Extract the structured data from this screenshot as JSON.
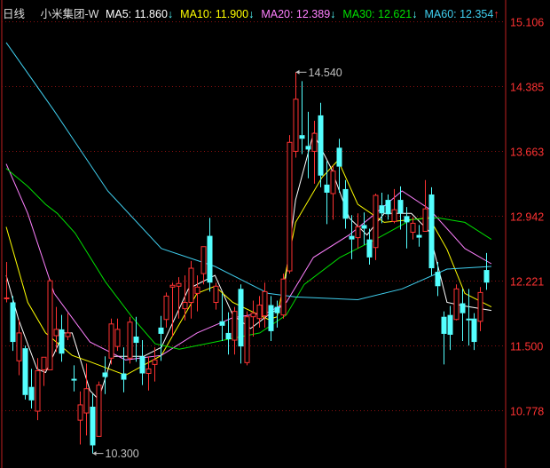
{
  "header": {
    "period": "日线",
    "name": "小米集团-W",
    "ma": [
      {
        "label": "MA5: 11.860",
        "arrow": "↓",
        "color": "#ffffff",
        "arrow_color": "#54ffff"
      },
      {
        "label": "MA10: 11.900",
        "arrow": "↓",
        "color": "#ffff00",
        "arrow_color": "#54ffff"
      },
      {
        "label": "MA20: 12.389",
        "arrow": "↓",
        "color": "#ff80ff",
        "arrow_color": "#54ffff"
      },
      {
        "label": "MA30: 12.621",
        "arrow": "↓",
        "color": "#00e000",
        "arrow_color": "#54ffff"
      },
      {
        "label": "MA60: 12.354",
        "arrow": "↑",
        "color": "#40d0f0",
        "arrow_color": "#ff3232"
      }
    ]
  },
  "colors": {
    "up": "#ff3232",
    "down": "#54ffff",
    "grid": "#8a1010",
    "axis": "#c02020",
    "axis_text": "#ff3232",
    "mark_text": "#c0c0c0"
  },
  "chart_data": {
    "type": "candlestick",
    "title": "小米集团-W 日线",
    "ylim": [
      10.25,
      15.2
    ],
    "yticks": [
      "15.106",
      "14.385",
      "13.663",
      "12.942",
      "12.221",
      "11.500",
      "10.778"
    ],
    "grid": true,
    "annotations": [
      {
        "text": "14.540",
        "index": 47,
        "price": 14.54
      },
      {
        "text": "10.300",
        "index": 14,
        "price": 10.3
      }
    ],
    "ohlc": [
      [
        12.03,
        12.43,
        11.98,
        12.03
      ],
      [
        11.98,
        12.05,
        11.44,
        11.54
      ],
      [
        11.33,
        11.79,
        11.17,
        11.64
      ],
      [
        11.47,
        11.5,
        10.9,
        10.95
      ],
      [
        11.04,
        11.24,
        10.8,
        10.89
      ],
      [
        10.77,
        11.36,
        10.67,
        11.22
      ],
      [
        11.23,
        11.37,
        11.05,
        11.37
      ],
      [
        11.23,
        12.24,
        11.23,
        12.22
      ],
      [
        11.61,
        11.93,
        11.43,
        11.68
      ],
      [
        11.68,
        11.84,
        11.32,
        11.41
      ],
      [
        11.6,
        11.86,
        11.56,
        11.64
      ],
      [
        11.13,
        11.28,
        10.99,
        11.11
      ],
      [
        10.67,
        10.99,
        10.4,
        10.84
      ],
      [
        10.75,
        11.3,
        10.5,
        11.02
      ],
      [
        10.82,
        10.96,
        10.3,
        10.39
      ],
      [
        10.49,
        11.1,
        10.49,
        11.06
      ],
      [
        11.2,
        11.38,
        10.96,
        11.15
      ],
      [
        11.36,
        11.8,
        11.29,
        11.74
      ],
      [
        11.49,
        11.8,
        11.44,
        11.68
      ],
      [
        11.19,
        11.48,
        10.98,
        11.12
      ],
      [
        11.36,
        11.82,
        11.3,
        11.76
      ],
      [
        11.6,
        11.82,
        11.32,
        11.53
      ],
      [
        11.38,
        11.56,
        11.06,
        11.19
      ],
      [
        11.19,
        11.38,
        11.0,
        11.24
      ],
      [
        11.29,
        11.48,
        11.1,
        11.34
      ],
      [
        11.7,
        11.83,
        11.33,
        11.63
      ],
      [
        11.79,
        12.09,
        11.7,
        12.05
      ],
      [
        12.15,
        12.2,
        11.6,
        12.17
      ],
      [
        12.16,
        12.26,
        11.8,
        12.19
      ],
      [
        11.91,
        12.28,
        11.78,
        11.98
      ],
      [
        11.98,
        12.44,
        11.8,
        12.36
      ],
      [
        12.08,
        12.28,
        11.88,
        12.15
      ],
      [
        12.3,
        12.6,
        12.18,
        12.6
      ],
      [
        12.72,
        12.92,
        12.1,
        12.2
      ],
      [
        11.98,
        12.2,
        11.9,
        12.16
      ],
      [
        11.77,
        12.08,
        11.55,
        11.72
      ],
      [
        11.64,
        11.87,
        11.4,
        11.57
      ],
      [
        11.56,
        11.93,
        11.4,
        11.88
      ],
      [
        12.13,
        12.18,
        11.3,
        11.49
      ],
      [
        11.31,
        11.88,
        11.28,
        11.82
      ],
      [
        11.82,
        12.0,
        11.6,
        11.86
      ],
      [
        11.8,
        12.05,
        11.7,
        11.95
      ],
      [
        11.83,
        12.2,
        11.7,
        12.1
      ],
      [
        11.95,
        12.05,
        11.55,
        11.66
      ],
      [
        11.93,
        12.0,
        11.7,
        11.86
      ],
      [
        11.84,
        12.3,
        11.8,
        12.24
      ],
      [
        12.33,
        13.84,
        12.3,
        13.76
      ],
      [
        13.66,
        14.54,
        13.59,
        14.24
      ],
      [
        13.84,
        14.44,
        13.63,
        13.8
      ],
      [
        13.72,
        14.1,
        13.36,
        13.68
      ],
      [
        13.66,
        14.0,
        13.3,
        13.86
      ],
      [
        14.06,
        14.2,
        13.26,
        13.39
      ],
      [
        13.29,
        13.55,
        12.85,
        13.2
      ],
      [
        13.19,
        13.5,
        12.9,
        13.44
      ],
      [
        13.7,
        13.8,
        13.2,
        13.49
      ],
      [
        13.24,
        13.34,
        12.8,
        12.91
      ],
      [
        12.72,
        12.95,
        12.46,
        12.68
      ],
      [
        12.7,
        12.97,
        12.58,
        12.82
      ],
      [
        12.84,
        12.98,
        12.62,
        12.8
      ],
      [
        12.68,
        12.8,
        12.4,
        12.48
      ],
      [
        12.59,
        13.19,
        12.45,
        13.17
      ],
      [
        13.06,
        13.2,
        12.86,
        12.97
      ],
      [
        13.12,
        13.18,
        12.9,
        12.96
      ],
      [
        12.88,
        13.24,
        12.86,
        13.01
      ],
      [
        13.12,
        13.27,
        12.79,
        12.97
      ],
      [
        12.94,
        13.04,
        12.58,
        12.87
      ],
      [
        12.76,
        12.93,
        12.68,
        12.86
      ],
      [
        12.73,
        12.84,
        12.6,
        12.7
      ],
      [
        12.77,
        13.34,
        12.77,
        13.02
      ],
      [
        13.18,
        13.26,
        12.28,
        12.36
      ],
      [
        12.32,
        12.43,
        12.05,
        12.16
      ],
      [
        11.82,
        11.88,
        11.29,
        11.63
      ],
      [
        11.84,
        11.94,
        11.45,
        11.62
      ],
      [
        11.79,
        12.18,
        11.78,
        12.13
      ],
      [
        11.97,
        12.13,
        11.55,
        11.86
      ],
      [
        11.8,
        12.13,
        11.5,
        11.78
      ],
      [
        11.8,
        11.86,
        11.45,
        11.54
      ],
      [
        11.77,
        12.15,
        11.66,
        12.09
      ],
      [
        12.34,
        12.53,
        12.12,
        12.2
      ]
    ],
    "ma_series": [
      {
        "name": "MA5",
        "color": "#ffffff",
        "points": [
          [
            0,
            12.28
          ],
          [
            2,
            11.79
          ],
          [
            5,
            11.24
          ],
          [
            6.4,
            11.2
          ],
          [
            9.3,
            11.64
          ],
          [
            10.7,
            11.64
          ],
          [
            13.6,
            11.0
          ],
          [
            15,
            10.9
          ],
          [
            17.2,
            11.38
          ],
          [
            19.4,
            11.38
          ],
          [
            22.3,
            11.38
          ],
          [
            25.2,
            11.48
          ],
          [
            29.6,
            12.13
          ],
          [
            33.9,
            12.28
          ],
          [
            36.8,
            11.84
          ],
          [
            39.7,
            11.69
          ],
          [
            42.6,
            11.84
          ],
          [
            44.8,
            11.94
          ],
          [
            47,
            13.12
          ],
          [
            49.9,
            13.86
          ],
          [
            52.8,
            13.47
          ],
          [
            55.7,
            12.92
          ],
          [
            58.6,
            12.73
          ],
          [
            61.4,
            12.97
          ],
          [
            65.8,
            12.97
          ],
          [
            68.7,
            12.77
          ],
          [
            71.6,
            11.98
          ],
          [
            74.5,
            11.94
          ],
          [
            78.8,
            11.89
          ]
        ]
      },
      {
        "name": "MA10",
        "color": "#ffff00",
        "points": [
          [
            0,
            12.82
          ],
          [
            3.5,
            11.98
          ],
          [
            6.4,
            11.64
          ],
          [
            10.7,
            11.39
          ],
          [
            13.6,
            11.32
          ],
          [
            19.4,
            11.17
          ],
          [
            25.2,
            11.39
          ],
          [
            31,
            12.08
          ],
          [
            33.9,
            12.16
          ],
          [
            36.8,
            11.98
          ],
          [
            42.6,
            11.79
          ],
          [
            44,
            11.82
          ],
          [
            47,
            12.87
          ],
          [
            51.3,
            13.37
          ],
          [
            53.9,
            13.56
          ],
          [
            57.1,
            13.07
          ],
          [
            61.4,
            12.87
          ],
          [
            68.7,
            12.92
          ],
          [
            71.6,
            12.57
          ],
          [
            74.5,
            12.08
          ],
          [
            78.8,
            11.93
          ]
        ]
      },
      {
        "name": "MA20",
        "color": "#ff80ff",
        "points": [
          [
            0,
            13.52
          ],
          [
            3.5,
            12.97
          ],
          [
            7.8,
            12.08
          ],
          [
            13.6,
            11.54
          ],
          [
            19.4,
            11.34
          ],
          [
            25.2,
            11.39
          ],
          [
            31,
            11.64
          ],
          [
            36.8,
            11.81
          ],
          [
            42.6,
            11.87
          ],
          [
            45.5,
            11.98
          ],
          [
            49.9,
            12.48
          ],
          [
            55.7,
            12.73
          ],
          [
            60,
            12.97
          ],
          [
            64.3,
            13.22
          ],
          [
            68.7,
            13.02
          ],
          [
            74.5,
            12.58
          ],
          [
            78.8,
            12.41
          ]
        ]
      },
      {
        "name": "MA30",
        "color": "#00e000",
        "points": [
          [
            0,
            13.47
          ],
          [
            3.5,
            13.27
          ],
          [
            6.4,
            13.07
          ],
          [
            8.3,
            12.97
          ],
          [
            11.2,
            12.75
          ],
          [
            16.1,
            12.21
          ],
          [
            20.4,
            11.82
          ],
          [
            24.2,
            11.52
          ],
          [
            28.1,
            11.46
          ],
          [
            33.9,
            11.54
          ],
          [
            41.2,
            11.64
          ],
          [
            45.5,
            11.84
          ],
          [
            48.4,
            12.18
          ],
          [
            54.2,
            12.48
          ],
          [
            60,
            12.68
          ],
          [
            65.8,
            12.9
          ],
          [
            70.1,
            12.92
          ],
          [
            74.5,
            12.87
          ],
          [
            78.8,
            12.68
          ]
        ]
      },
      {
        "name": "MA60",
        "color": "#40d0f0",
        "points": [
          [
            0,
            14.87
          ],
          [
            7.8,
            14.11
          ],
          [
            16.5,
            13.22
          ],
          [
            25.2,
            12.58
          ],
          [
            33.9,
            12.38
          ],
          [
            42.6,
            12.08
          ],
          [
            47,
            12.04
          ],
          [
            57.1,
            12.01
          ],
          [
            64.3,
            12.13
          ],
          [
            71.6,
            12.35
          ],
          [
            78.8,
            12.38
          ]
        ]
      }
    ]
  }
}
